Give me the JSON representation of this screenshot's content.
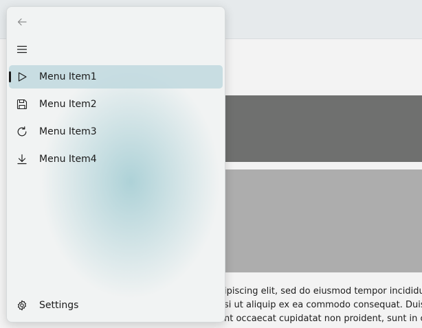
{
  "background": {
    "text_lines": [
      "ipiscing elit, sed do eiusmod tempor incididu",
      "si ut aliquip ex ea commodo consequat. Duis",
      "nt occaecat cupidatat non proident, sunt in cul"
    ]
  },
  "nav": {
    "back_icon": "arrow-left-icon",
    "menu_icon": "hamburger-icon",
    "items": [
      {
        "label": "Menu Item1",
        "icon": "play-icon",
        "selected": true
      },
      {
        "label": "Menu Item2",
        "icon": "save-icon",
        "selected": false
      },
      {
        "label": "Menu Item3",
        "icon": "refresh-icon",
        "selected": false
      },
      {
        "label": "Menu Item4",
        "icon": "download-icon",
        "selected": false
      }
    ],
    "settings": {
      "label": "Settings",
      "icon": "gear-icon"
    }
  },
  "colors": {
    "selected_bg": "#b9d6dc",
    "indicator": "#1a1a1a",
    "pane_tint": "#aad0d6"
  }
}
